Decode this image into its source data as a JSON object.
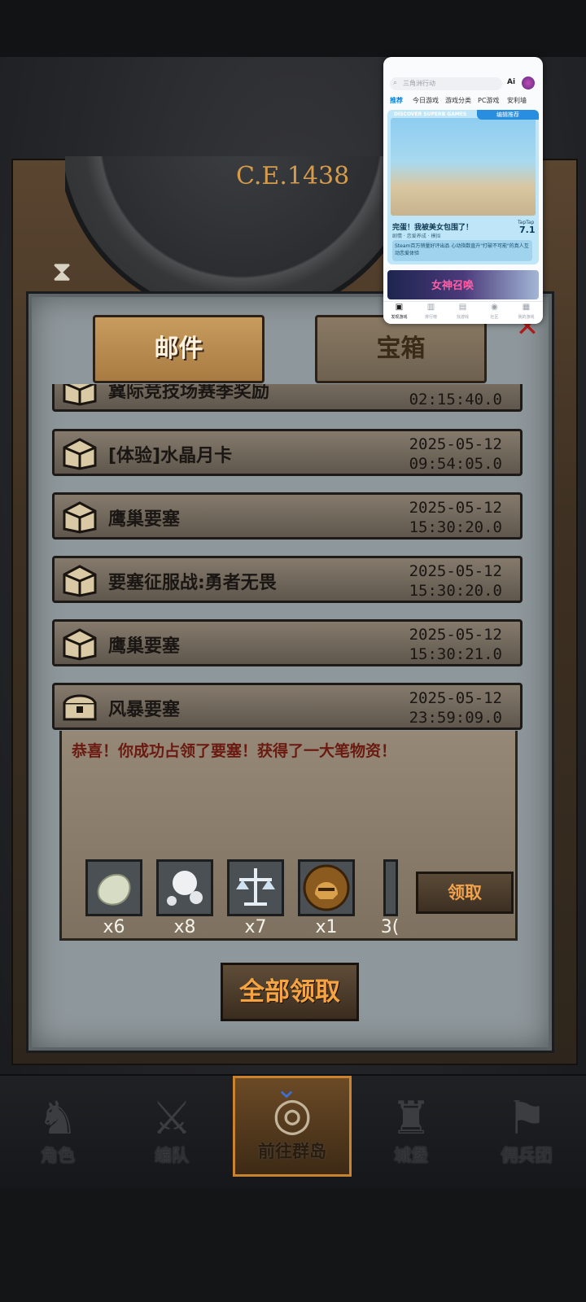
{
  "scene": {
    "era_label": "C.E.1438"
  },
  "panel": {
    "tabs": [
      {
        "label": "邮件",
        "active": true
      },
      {
        "label": "宝箱",
        "active": false
      }
    ],
    "mails": [
      {
        "title": "冀际竞技场赛季奖励",
        "date": "",
        "time": "02:15:40.0"
      },
      {
        "title": "[体验]水晶月卡",
        "date": "2025-05-12",
        "time": "09:54:05.0"
      },
      {
        "title": "鹰巢要塞",
        "date": "2025-05-12",
        "time": "15:30:20.0"
      },
      {
        "title": "要塞征服战:勇者无畏",
        "date": "2025-05-12",
        "time": "15:30:20.0"
      },
      {
        "title": "鹰巢要塞",
        "date": "2025-05-12",
        "time": "15:30:21.0"
      },
      {
        "title": "风暴要塞",
        "date": "2025-05-12",
        "time": "23:59:09.0"
      }
    ],
    "expanded": {
      "message": "恭喜！你成功占领了要塞！获得了一大笔物资！",
      "rewards": [
        {
          "icon": "stone-icon",
          "qty": "x6"
        },
        {
          "icon": "pearl-icon",
          "qty": "x8"
        },
        {
          "icon": "scales-icon",
          "qty": "x7"
        },
        {
          "icon": "helmet-icon",
          "qty": "x1"
        },
        {
          "icon": "partial-item-icon",
          "qty": "3("
        }
      ],
      "claim_label": "领取"
    },
    "claim_all_label": "全部领取"
  },
  "bottom_nav": {
    "items": [
      {
        "label": "角色",
        "icon": "knight-icon"
      },
      {
        "label": "编队",
        "icon": "squad-icon"
      },
      {
        "label": "前往群岛",
        "icon": "globe-icon",
        "active": true
      },
      {
        "label": "城堡",
        "icon": "castle-icon"
      },
      {
        "label": "佣兵团",
        "icon": "banner-icon"
      }
    ]
  },
  "store_overlay": {
    "search_placeholder": "三角洲行动",
    "ai_label": "Ai",
    "tabs": [
      "推荐",
      "今日游戏",
      "游戏分类",
      "PC游戏",
      "安利墙"
    ],
    "banner": {
      "tag": "编辑推荐",
      "discover": "DISCOVER SUPERB GAMES",
      "title": "完蛋！我被美女包围了！",
      "subtitle": "剧情 · 恋爱养成 · 模拟",
      "score_label": "TapTap",
      "score": "7.1",
      "description": "Steam百万销量好评出品 心动指数直升\"打破不可能\"的真人互动恋爱体验"
    },
    "banner2_title": "女神召唤",
    "nav": [
      "发现游戏",
      "排行榜",
      "找游戏",
      "社区",
      "我的游戏"
    ]
  },
  "colors": {
    "accent_orange": "#f6a441",
    "panel_bg": "#8e979b",
    "store_accent": "#0a84d6"
  }
}
